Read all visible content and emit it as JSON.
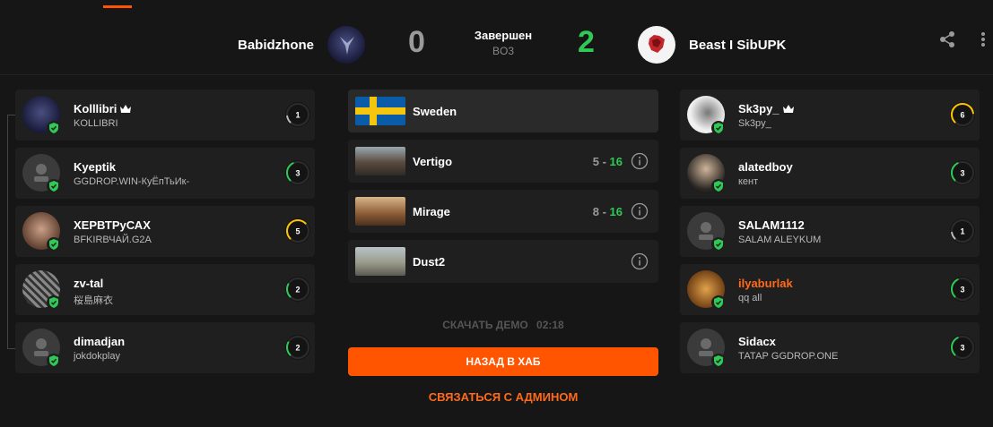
{
  "header": {
    "team1": {
      "name": "Babidzhone",
      "score": "0"
    },
    "team2": {
      "name": "Beast I SibUPK",
      "score": "2"
    },
    "status": "Завершен",
    "format": "BO3",
    "colors": {
      "win": "#2fca55",
      "lose": "#9a9a9a",
      "accent": "#ff5500"
    }
  },
  "team1_players": [
    {
      "name": "Kolllibri",
      "sub": "KOLLIBRI",
      "captain": true,
      "level": "1"
    },
    {
      "name": "Kyeptik",
      "sub": "GGDROP.WIN-КуЁпТьИк-",
      "level": "3"
    },
    {
      "name": "ХЕРВТРуСАХ",
      "sub": "BFKIRВЧАЙ.G2A",
      "level": "5"
    },
    {
      "name": "zv-tal",
      "sub": "桜島麻衣",
      "level": "2"
    },
    {
      "name": "dimadjan",
      "sub": "jokdokplay",
      "level": "2"
    }
  ],
  "team2_players": [
    {
      "name": "Sk3py_",
      "sub": "Sk3py_",
      "captain": true,
      "level": "6"
    },
    {
      "name": "alatedboy",
      "sub": "кент",
      "level": "3"
    },
    {
      "name": "SALAM1112",
      "sub": "SALAM ALEYKUM",
      "level": "1"
    },
    {
      "name": "ilyaburlak",
      "sub": "qq all",
      "level": "3"
    },
    {
      "name": "Sidacx",
      "sub": "ТАТАР GGDROP.ONE",
      "level": "3"
    }
  ],
  "maps": {
    "server": "Sweden",
    "list": [
      {
        "name": "Vertigo",
        "lose": "5",
        "sep": " - ",
        "win": "16"
      },
      {
        "name": "Mirage",
        "lose": "8",
        "sep": " - ",
        "win": "16"
      },
      {
        "name": "Dust2"
      }
    ]
  },
  "actions": {
    "demo_label": "СКАЧАТЬ ДЕМО",
    "demo_time": "02:18",
    "back_button": "НАЗАД В ХАБ",
    "admin_link": "СВЯЗАТЬСЯ С АДМИНОМ"
  },
  "icons": [
    "share-icon",
    "more-icon",
    "crown-icon",
    "shield-icon",
    "info-icon",
    "sweden-flag-icon",
    "default-avatar-icon"
  ]
}
